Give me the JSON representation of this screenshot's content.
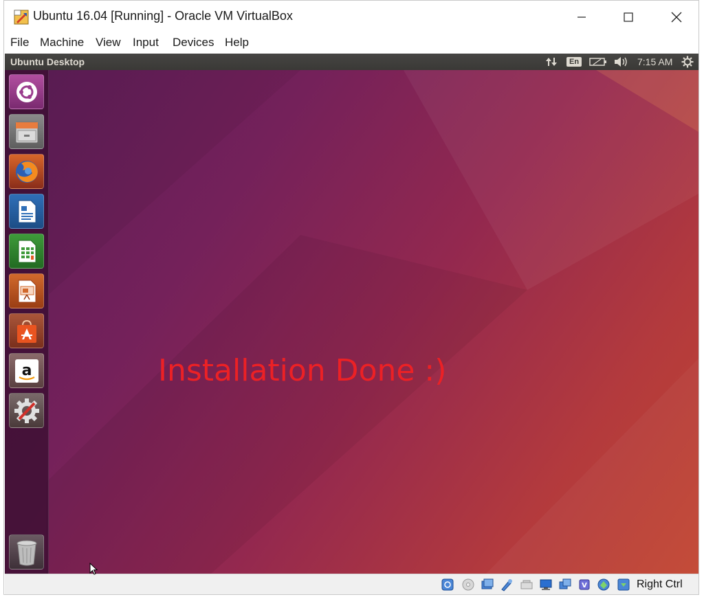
{
  "window": {
    "title": "Ubuntu 16.04 [Running] - Oracle VM VirtualBox",
    "icon": "virtualbox-app-icon",
    "controls": [
      "minimize",
      "maximize",
      "close"
    ]
  },
  "menubar": {
    "items": [
      "File",
      "Machine",
      "View",
      "Input",
      "Devices",
      "Help"
    ]
  },
  "guest": {
    "top_panel": {
      "title": "Ubuntu Desktop",
      "keyboard_layout": "En",
      "clock": "7:15 AM",
      "indicators": [
        "network-arrows-icon",
        "keyboard-layout-icon",
        "battery-icon",
        "sound-icon",
        "system-settings-icon"
      ]
    },
    "launcher": {
      "items": [
        "dash-home",
        "files",
        "firefox",
        "libreoffice-writer",
        "libreoffice-calc",
        "libreoffice-impress",
        "ubuntu-software",
        "amazon",
        "system-settings",
        "trash"
      ]
    },
    "desktop_text": "Installation Done :)",
    "desktop_text_color": "#ec2125"
  },
  "statusbar": {
    "host_key": "Right Ctrl",
    "icons": [
      "hard-disk",
      "optical-drive",
      "audio",
      "network",
      "usb",
      "shared-folders",
      "display",
      "video-capture",
      "cpu",
      "mouse-integration",
      "host-key"
    ]
  },
  "colors": {
    "ubuntu_orange": "#e95420",
    "panel_bg": "#3a3936",
    "wallpaper_purple": "#5a1d57",
    "wallpaper_orange": "#c24530"
  }
}
